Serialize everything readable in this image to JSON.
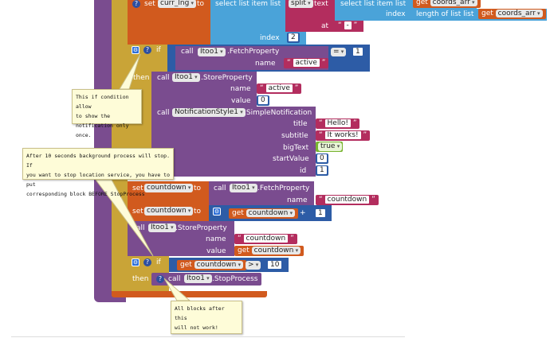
{
  "colors": {
    "procedure": "#7a4c8f",
    "variables": "#d15a1e",
    "lists": "#4aa3d9",
    "text": "#b32d5e",
    "math": "#2d5ca6",
    "logic": "#77b32f",
    "control": "#c9a437",
    "comment": "#fefcd8"
  },
  "top": {
    "set_kw": "set",
    "var": "curr_lng",
    "to_kw": "to",
    "select_kw": "select list item  list",
    "split_kw": "split",
    "text_kw": "text",
    "select2_kw": "select list item  list",
    "get_kw": "get",
    "coords": "coords_arr",
    "index_kw": "index",
    "length_kw": "length of list  list",
    "at_kw": "at",
    "sep": "-",
    "index2_kw": "index",
    "index2_val": "2"
  },
  "if1": {
    "if_kw": "if",
    "call_kw": "call",
    "comp": "Itoo1",
    "method": ".FetchProperty",
    "name_kw": "name",
    "name_val": "active",
    "op": "=",
    "rhs": "1",
    "then_kw": "then"
  },
  "store1": {
    "call_kw": "call",
    "comp": "Itoo1",
    "method": ".StoreProperty",
    "name_kw": "name",
    "name_val": "active",
    "value_kw": "value",
    "value_val": "0"
  },
  "notif": {
    "call_kw": "call",
    "comp": "NotificationStyle1",
    "method": ".SimpleNotification",
    "title_kw": "title",
    "title_val": "Hello!",
    "subtitle_kw": "subtitle",
    "subtitle_val": "It works!",
    "bigtext_kw": "bigText",
    "bigtext_val": "true",
    "startvalue_kw": "startValue",
    "startvalue_val": "0",
    "id_kw": "id",
    "id_val": "1"
  },
  "cd1": {
    "set_kw": "set",
    "var": "countdown",
    "to_kw": "to",
    "call_kw": "call",
    "comp": "Itoo1",
    "method": ".FetchProperty",
    "name_kw": "name",
    "name_val": "countdown"
  },
  "cd2": {
    "set_kw": "set",
    "var": "countdown",
    "to_kw": "to",
    "get_kw": "get",
    "get_var": "countdown",
    "op": "+",
    "rhs": "1"
  },
  "store2": {
    "call_kw": "call",
    "comp": "Itoo1",
    "method": ".StoreProperty",
    "name_kw": "name",
    "name_val": "countdown",
    "value_kw": "value",
    "get_kw": "get",
    "get_var": "countdown"
  },
  "if2": {
    "if_kw": "if",
    "get_kw": "get",
    "get_var": "countdown",
    "op": ">",
    "rhs": "10",
    "then_kw": "then",
    "call_kw": "call",
    "comp": "Itoo1",
    "method": ".StopProcess"
  },
  "comments": {
    "c1": [
      "This if condition allow",
      "to show the",
      "notification only once."
    ],
    "c2": [
      "After 10 seconds background process will stop. If",
      "you want to stop location service, you have to put",
      "corresponding block BEFORE StopProcess"
    ],
    "c3": [
      "All blocks after this",
      "will not work!"
    ]
  }
}
